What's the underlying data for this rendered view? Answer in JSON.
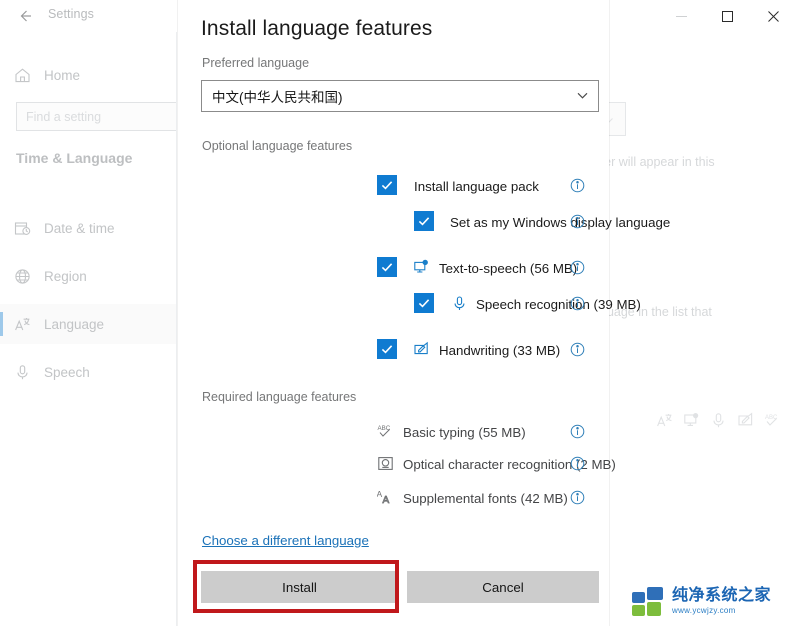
{
  "window": {
    "app_title": "Settings",
    "back_icon": "back-arrow-icon",
    "controls": [
      {
        "name": "minimize",
        "glyph": "minimize-icon"
      },
      {
        "name": "maximize",
        "glyph": "maximize-icon"
      },
      {
        "name": "close",
        "glyph": "close-icon"
      }
    ]
  },
  "sidebar": {
    "home": {
      "label": "Home",
      "icon": "home-icon"
    },
    "search": {
      "placeholder": "Find a setting",
      "icon": "search-icon"
    },
    "section_title": "Time & Language",
    "items": [
      {
        "label": "Date & time",
        "icon": "calendar-clock-icon",
        "selected": false
      },
      {
        "label": "Region",
        "icon": "globe-icon",
        "selected": false
      },
      {
        "label": "Language",
        "icon": "language-icon",
        "selected": true
      },
      {
        "label": "Speech",
        "icon": "microphone-icon",
        "selected": false
      }
    ]
  },
  "background_content": {
    "line1": "rer will appear in this",
    "line2": "guage in the list that",
    "feature_icons": [
      "language-icon",
      "text-to-speech-icon",
      "microphone-icon",
      "handwriting-icon",
      "basic-typing-icon"
    ]
  },
  "dialog": {
    "title": "Install language features",
    "preferred_label": "Preferred language",
    "preferred_value": "中文(中华人民共和国)",
    "dropdown_icon": "chevron-down-icon",
    "optional_label": "Optional language features",
    "optional_features": [
      {
        "label": "Install language pack",
        "checked": true,
        "indent": 0,
        "icon": null,
        "info_icon": "info-icon"
      },
      {
        "label": "Set as my Windows display language",
        "checked": true,
        "indent": 1,
        "icon": null,
        "info_icon": "info-icon"
      },
      {
        "label": "Text-to-speech (56 MB)",
        "checked": true,
        "indent": 0,
        "icon": "text-to-speech-icon",
        "info_icon": "info-icon"
      },
      {
        "label": "Speech recognition (39 MB)",
        "checked": true,
        "indent": 1,
        "icon": "microphone-icon",
        "info_icon": "info-icon"
      },
      {
        "label": "Handwriting (33 MB)",
        "checked": true,
        "indent": 0,
        "icon": "handwriting-icon",
        "info_icon": "info-icon"
      }
    ],
    "required_label": "Required language features",
    "required_features": [
      {
        "label": "Basic typing (55 MB)",
        "icon": "abc-check-icon",
        "info_icon": "info-icon"
      },
      {
        "label": "Optical character recognition (2 MB)",
        "icon": "ocr-icon",
        "info_icon": "info-icon"
      },
      {
        "label": "Supplemental fonts (42 MB)",
        "icon": "fonts-icon",
        "info_icon": "info-icon"
      }
    ],
    "choose_link": "Choose a different language",
    "install_button": "Install",
    "cancel_button": "Cancel"
  },
  "watermark": {
    "name": "纯净系统之家",
    "url": "www.ycwjzy.com"
  },
  "colors": {
    "accent": "#0f7bd1",
    "link": "#1b72b8",
    "info": "#2f7fb8",
    "highlight_box": "#c0181b",
    "button_face": "#cccccc",
    "selected_indicator": "#9ec9ea"
  }
}
